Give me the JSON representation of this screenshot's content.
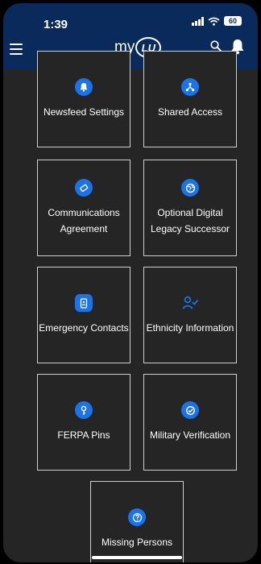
{
  "status": {
    "time": "1:39",
    "battery": "60"
  },
  "header": {
    "logo_prefix": "my",
    "logo_badge": "LU"
  },
  "tiles": [
    {
      "label": "Newsfeed Settings",
      "icon": "bell-icon"
    },
    {
      "label": "Shared Access",
      "icon": "share-nodes-icon"
    },
    {
      "label": "Communications Agreement",
      "icon": "handshake-icon"
    },
    {
      "label": "Optional Digital Legacy Successor",
      "icon": "globe-icon"
    },
    {
      "label": "Emergency Contacts",
      "icon": "phone-contact-icon"
    },
    {
      "label": "Ethnicity Information",
      "icon": "person-check-icon"
    },
    {
      "label": "FERPA Pins",
      "icon": "pin-icon"
    },
    {
      "label": "Military Verification",
      "icon": "check-badge-icon"
    },
    {
      "label": "Missing Persons",
      "icon": "question-icon"
    }
  ],
  "colors": {
    "header": "#0a2a5c",
    "background": "#252525",
    "icon_bg": "#1a73e8",
    "border": "#cfcfcf"
  }
}
